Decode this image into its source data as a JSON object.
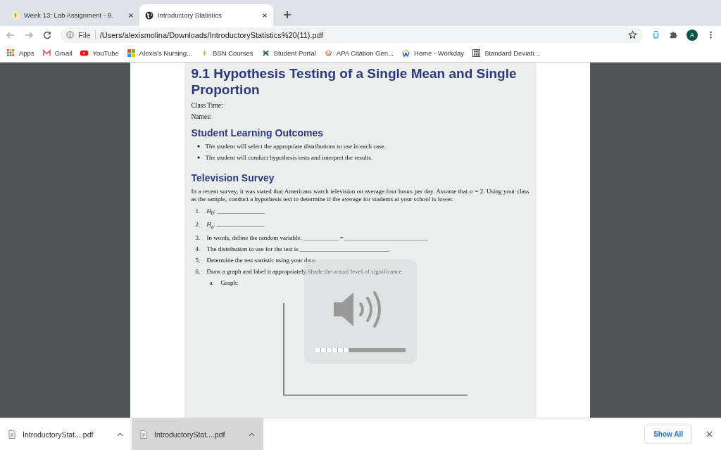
{
  "tabs": [
    {
      "title": "Week 13: Lab Assignment - 9.",
      "selected": false
    },
    {
      "title": "Introductory Statistics",
      "selected": true
    }
  ],
  "address": {
    "scheme": "File",
    "url": "/Users/alexismolina/Downloads/IntroductoryStatistics%20(11).pdf"
  },
  "profile": "A",
  "bookmarks": [
    {
      "label": "Apps"
    },
    {
      "label": "Gmail"
    },
    {
      "label": "YouTube"
    },
    {
      "label": "Alexis's Nursing..."
    },
    {
      "label": "BSN Courses"
    },
    {
      "label": "Student Portal"
    },
    {
      "label": "APA Citation Gen..."
    },
    {
      "label": "Home - Workday"
    },
    {
      "label": "Standard Deviati..."
    }
  ],
  "document": {
    "title": "9.1 Hypothesis Testing of a Single Mean and Single Proportion",
    "fields": [
      "Class Time:",
      "Names:"
    ],
    "outcomes_heading": "Student Learning Outcomes",
    "outcomes": [
      "The student will select the appropriate distributions to use in each case.",
      "The student will conduct hypothesis tests and interpret the results."
    ],
    "survey_heading": "Television Survey",
    "survey_text": "In a recent survey, it was stated that Americans watch television on average four hours per day. Assume that σ = 2. Using your class as the sample, conduct a hypothesis test to determine if the average for students at your school is lower.",
    "steps": [
      {
        "number": "1.",
        "text": "*H*$_{0}$: _______________"
      },
      {
        "number": "2.",
        "text": "*H*$_{a}$: _______________"
      },
      {
        "number": "3.",
        "text": "In words, define the random variable. ___________ = __________________________"
      },
      {
        "number": "4.",
        "text": "The distribution to use for the test is ____________________________."
      },
      {
        "number": "5.",
        "text": "Determine the test statistic using your data."
      },
      {
        "number": "6.",
        "text": "Draw a graph and label it appropriately.Shade the actual level of significance."
      }
    ],
    "substep": {
      "number": "a.",
      "text": "Graph:"
    }
  },
  "volume": {
    "level": 0.375
  },
  "downloads": [
    {
      "name": "IntroductoryStat....pdf",
      "selected": false
    },
    {
      "name": "IntroductoryStat....pdf",
      "selected": true
    }
  ],
  "show_all": "Show All"
}
